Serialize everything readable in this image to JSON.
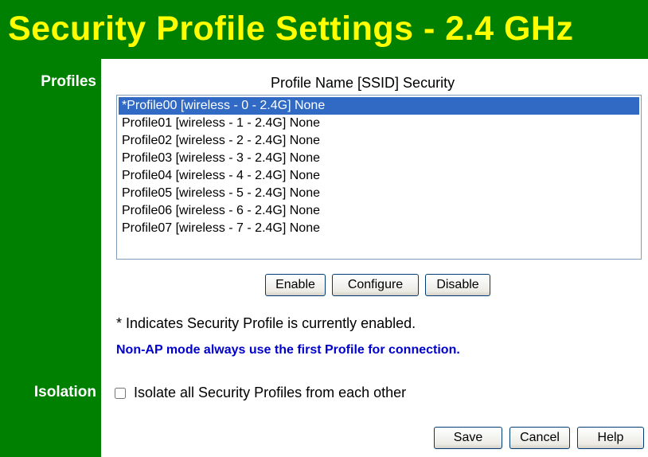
{
  "page": {
    "title": "Security Profile Settings - 2.4 GHz"
  },
  "sidebar": {
    "profiles_label": "Profiles",
    "isolation_label": "Isolation"
  },
  "profiles": {
    "heading": "Profile Name [SSID] Security",
    "items": [
      {
        "label": "*Profile00 [wireless - 0 - 2.4G] None",
        "selected": true
      },
      {
        "label": "Profile01 [wireless - 1 - 2.4G] None",
        "selected": false
      },
      {
        "label": "Profile02 [wireless - 2 - 2.4G] None",
        "selected": false
      },
      {
        "label": "Profile03 [wireless - 3 - 2.4G] None",
        "selected": false
      },
      {
        "label": "Profile04 [wireless - 4 - 2.4G] None",
        "selected": false
      },
      {
        "label": "Profile05 [wireless - 5 - 2.4G] None",
        "selected": false
      },
      {
        "label": "Profile06 [wireless - 6 - 2.4G] None",
        "selected": false
      },
      {
        "label": "Profile07 [wireless - 7 - 2.4G] None",
        "selected": false
      }
    ],
    "buttons": {
      "enable": "Enable",
      "configure": "Configure",
      "disable": "Disable"
    }
  },
  "note": "* Indicates Security Profile is currently enabled.",
  "warning": "Non-AP mode always use the first Profile for connection.",
  "isolation": {
    "label": "Isolate all Security Profiles from each other",
    "checked": false
  },
  "footer": {
    "save": "Save",
    "cancel": "Cancel",
    "help": "Help"
  },
  "colors": {
    "header_bg": "#008000",
    "title_text": "#ffff00",
    "selection": "#316ac5",
    "warning_text": "#0000cc"
  }
}
